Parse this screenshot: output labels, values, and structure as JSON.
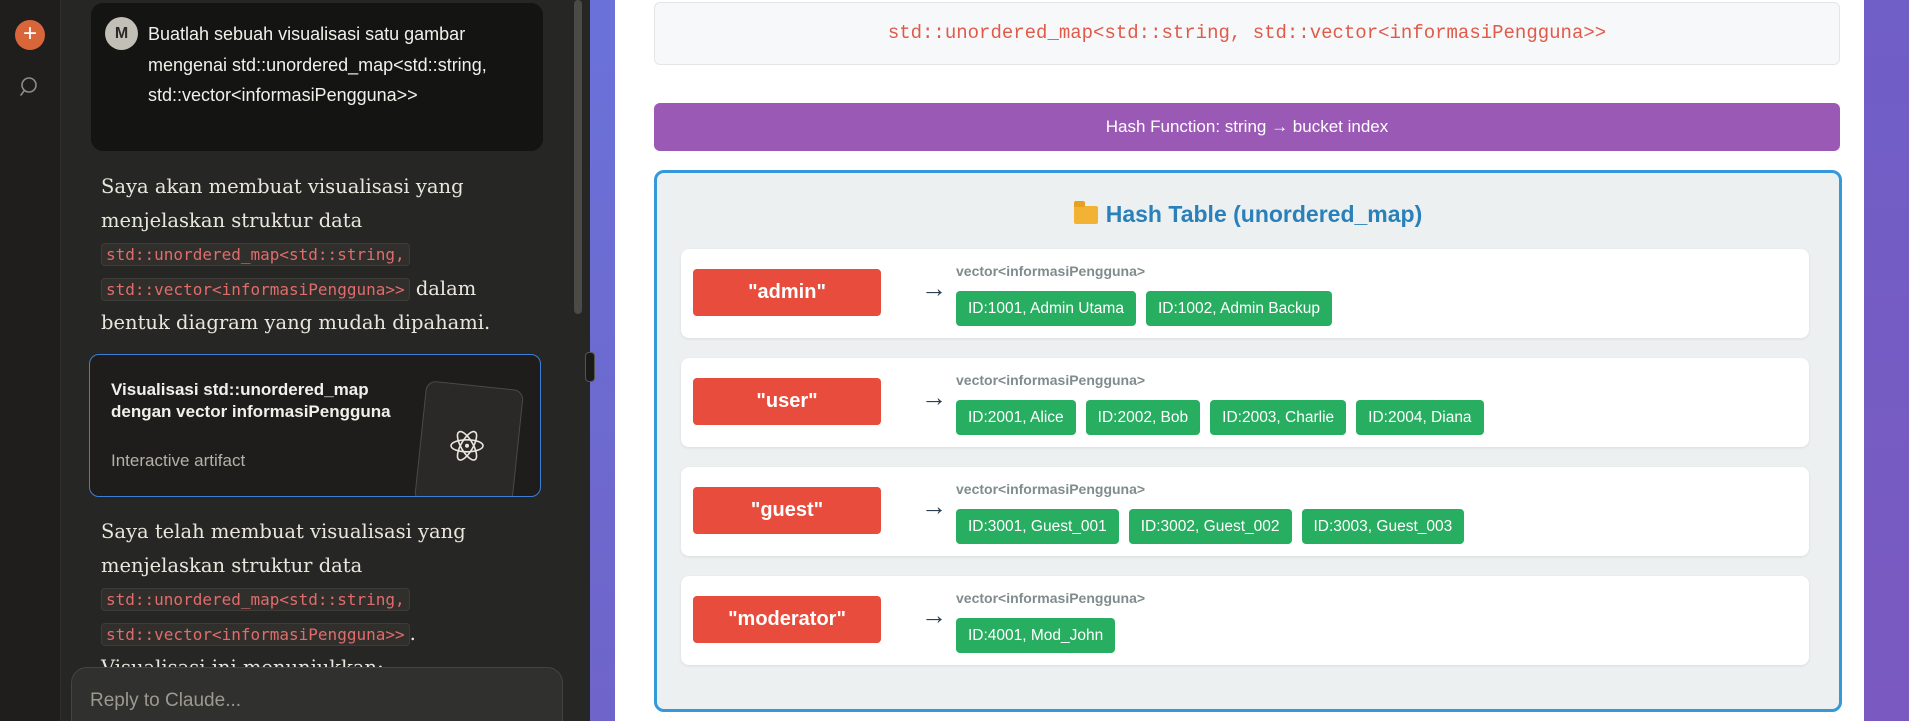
{
  "sidebar": {
    "new_icon": "+",
    "search_icon": "search-icon"
  },
  "chat": {
    "user_avatar": "M",
    "user_message": "Buatlah sebuah visualisasi satu gambar mengenai std::unordered_map<std::string, std::vector<informasiPengguna>>",
    "assistant_1": {
      "prefix": "Saya akan membuat visualisasi yang menjelaskan struktur data ",
      "code_1": "std::unordered_map<std::string,",
      "code_2": "std::vector<informasiPengguna>>",
      "suffix": " dalam bentuk diagram yang mudah dipahami."
    },
    "artifact_card": {
      "title": "Visualisasi std::unordered_map dengan vector informasiPengguna",
      "subtitle": "Interactive artifact",
      "icon": "react-atom-icon"
    },
    "assistant_2": {
      "prefix": "Saya telah membuat visualisasi yang menjelaskan struktur data ",
      "code_1": "std::unordered_map<std::string,",
      "code_2": "std::vector<informasiPengguna>>",
      "suffix": ".",
      "next_line": "Visualisasi ini menunjukkan:"
    },
    "reply_placeholder": "Reply to Claude..."
  },
  "artifact": {
    "type_declaration": "std::unordered_map<std::string, std::vector<informasiPengguna>>",
    "hash_function": "Hash Function: string → bucket index",
    "table_title": "Hash Table (unordered_map)",
    "arrow": "→",
    "rows": [
      {
        "key": "\"admin\"",
        "vector_label": "vector<informasiPengguna>",
        "items": [
          "ID:1001, Admin Utama",
          "ID:1002, Admin Backup"
        ]
      },
      {
        "key": "\"user\"",
        "vector_label": "vector<informasiPengguna>",
        "items": [
          "ID:2001, Alice",
          "ID:2002, Bob",
          "ID:2003, Charlie",
          "ID:2004, Diana"
        ]
      },
      {
        "key": "\"guest\"",
        "vector_label": "vector<informasiPengguna>",
        "items": [
          "ID:3001, Guest_001",
          "ID:3002, Guest_002",
          "ID:3003, Guest_003"
        ]
      },
      {
        "key": "\"moderator\"",
        "vector_label": "vector<informasiPengguna>",
        "items": [
          "ID:4001, Mod_John"
        ]
      }
    ]
  },
  "colors": {
    "accent_new": "#d9663b",
    "hash_bar": "#9b59b6",
    "table_border": "#3498db",
    "key": "#e74c3c",
    "item": "#27ae60",
    "code": "#e05a4a"
  }
}
